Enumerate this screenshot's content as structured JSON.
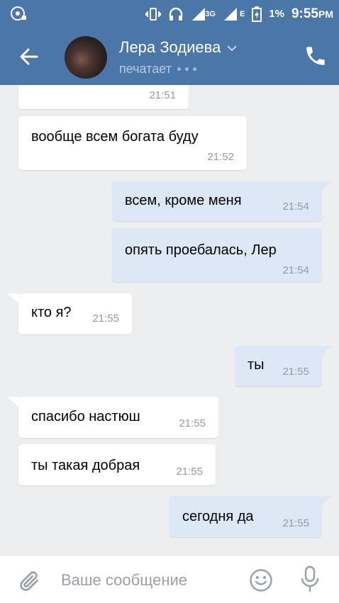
{
  "status_bar": {
    "network": "3G",
    "lte_label": "E",
    "battery": "1%",
    "time": "9:55",
    "time_suffix": "PM"
  },
  "header": {
    "contact_name": "Лера Зодиева",
    "status": "печатает"
  },
  "messages": [
    {
      "dir": "in",
      "text": "",
      "time": "21:51"
    },
    {
      "dir": "in",
      "text": "вообще всем богата буду",
      "time": "21:52"
    },
    {
      "dir": "out",
      "text": "всем, кроме меня",
      "time": "21:54"
    },
    {
      "dir": "out",
      "text": "опять проебалась, Лер",
      "time": "21:54"
    },
    {
      "dir": "in",
      "text": "кто я?",
      "time": "21:55"
    },
    {
      "dir": "out",
      "text": "ты",
      "time": "21:55"
    },
    {
      "dir": "in",
      "text": "спасибо настюш",
      "time": "21:55"
    },
    {
      "dir": "in",
      "text": "ты такая добрая",
      "time": "21:55"
    },
    {
      "dir": "out",
      "text": "сегодня да",
      "time": "21:55"
    }
  ],
  "composer": {
    "placeholder": "Ваше сообщение"
  },
  "colors": {
    "header_bg": "#4a76a8",
    "outgoing_bubble": "#dce8f6",
    "incoming_bubble": "#ffffff",
    "chat_bg": "#edeef0",
    "icon_gray": "#9aa0a8"
  }
}
